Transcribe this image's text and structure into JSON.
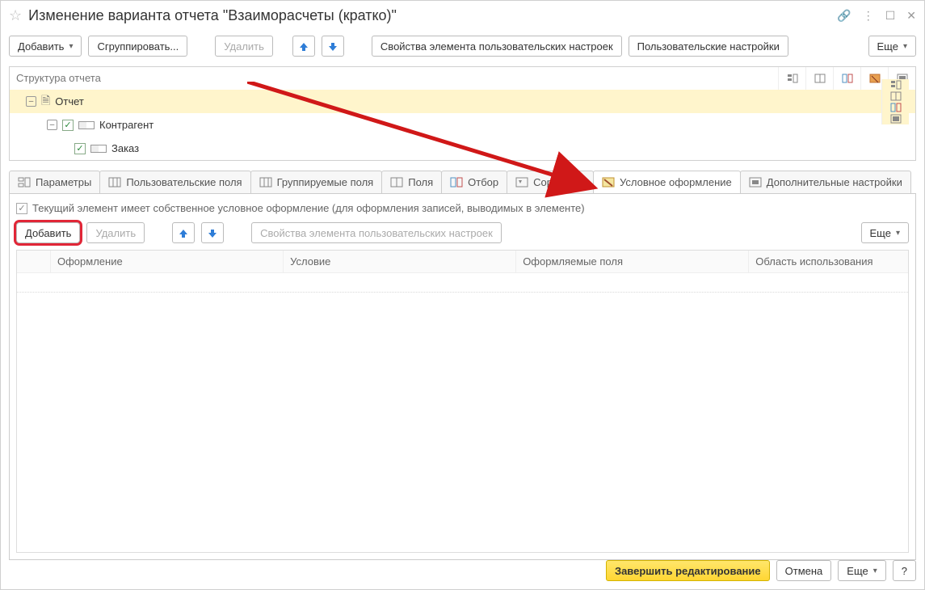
{
  "title": "Изменение варианта отчета \"Взаиморасчеты (кратко)\"",
  "toolbar": {
    "add_label": "Добавить",
    "group_label": "Сгруппировать...",
    "delete_label": "Удалить",
    "custom_props_label": "Свойства элемента пользовательских настроек",
    "user_settings_label": "Пользовательские настройки",
    "more_label": "Еще"
  },
  "structure": {
    "header_label": "Структура отчета",
    "rows": [
      {
        "label": "Отчет"
      },
      {
        "label": "Контрагент"
      },
      {
        "label": "Заказ"
      }
    ]
  },
  "tabs": [
    {
      "label": "Параметры"
    },
    {
      "label": "Пользовательские поля"
    },
    {
      "label": "Группируемые поля"
    },
    {
      "label": "Поля"
    },
    {
      "label": "Отбор"
    },
    {
      "label": "Сортировк"
    },
    {
      "label": "Условное оформление"
    },
    {
      "label": "Дополнительные настройки"
    }
  ],
  "panel": {
    "check_text": "Текущий элемент имеет собственное условное оформление (для оформления записей, выводимых в элементе)",
    "add_label": "Добавить",
    "delete_label": "Удалить",
    "custom_props_label": "Свойства элемента пользовательских настроек",
    "more_label": "Еще"
  },
  "grid": {
    "columns": [
      "Оформление",
      "Условие",
      "Оформляемые поля",
      "Область использования"
    ]
  },
  "footer": {
    "finish_label": "Завершить редактирование",
    "cancel_label": "Отмена",
    "more_label": "Еще",
    "help_label": "?"
  }
}
